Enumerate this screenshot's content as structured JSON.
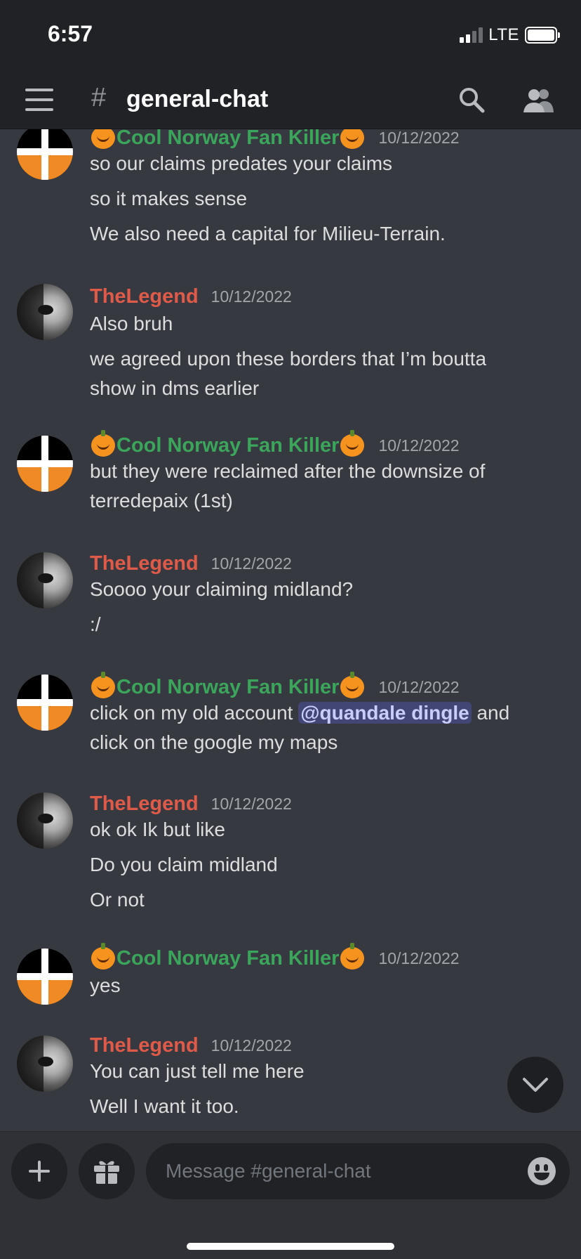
{
  "status": {
    "time": "6:57",
    "network": "LTE"
  },
  "header": {
    "hash": "#",
    "channel": "general-chat"
  },
  "messages": [
    {
      "author": "Cool Norway Fan Killer",
      "author_prefix": "🎃",
      "author_suffix": "🎃",
      "timestamp": "10/12/2022",
      "avatar": "flag",
      "lines": [
        "so our claims predates your claims",
        "so it makes sense",
        "We also need a capital for Milieu-Terrain."
      ]
    },
    {
      "author": "TheLegend",
      "timestamp": "10/12/2022",
      "avatar": "face",
      "lines": [
        "Also bruh",
        "we agreed upon these borders that I’m boutta",
        "show in dms earlier"
      ]
    },
    {
      "author": "Cool Norway Fan Killer",
      "author_prefix": "🎃",
      "author_suffix": "🎃",
      "timestamp": "10/12/2022",
      "avatar": "flag",
      "lines": [
        "but they were reclaimed after the downsize of",
        "terredepaix (1st)"
      ]
    },
    {
      "author": "TheLegend",
      "timestamp": "10/12/2022",
      "avatar": "face",
      "lines": [
        "Soooo your claiming midland?",
        ":/"
      ]
    },
    {
      "author": "Cool Norway Fan Killer",
      "author_prefix": "🎃",
      "author_suffix": "🎃",
      "timestamp": "10/12/2022",
      "avatar": "flag",
      "line1_before": "click on my old account ",
      "mention": "@quandale dingle",
      "line1_after": " and",
      "lines": [
        "click on the google my maps"
      ]
    },
    {
      "author": "TheLegend",
      "timestamp": "10/12/2022",
      "avatar": "face",
      "lines": [
        "ok ok Ik but like",
        "Do you claim midland",
        "Or not"
      ]
    },
    {
      "author": "Cool Norway Fan Killer",
      "author_prefix": "🎃",
      "author_suffix": "🎃",
      "timestamp": "10/12/2022",
      "avatar": "flag",
      "lines": [
        "yes"
      ]
    },
    {
      "author": "TheLegend",
      "timestamp": "10/12/2022",
      "avatar": "face",
      "lines": [
        "You can just tell me here",
        "Well I want it too."
      ]
    }
  ],
  "composer": {
    "placeholder": "Message #general-chat"
  },
  "icons": {
    "menu": "hamburger-icon",
    "search": "search-icon",
    "members": "members-icon",
    "add": "plus-icon",
    "gift": "gift-icon",
    "emoji": "emoji-icon",
    "scroll": "chevron-down-icon"
  },
  "colors": {
    "background": "#36393f",
    "header": "#202225",
    "green_author": "#3ba55c",
    "red_author": "#e05a4a",
    "mention_bg": "#414675",
    "text": "#dcddde"
  }
}
